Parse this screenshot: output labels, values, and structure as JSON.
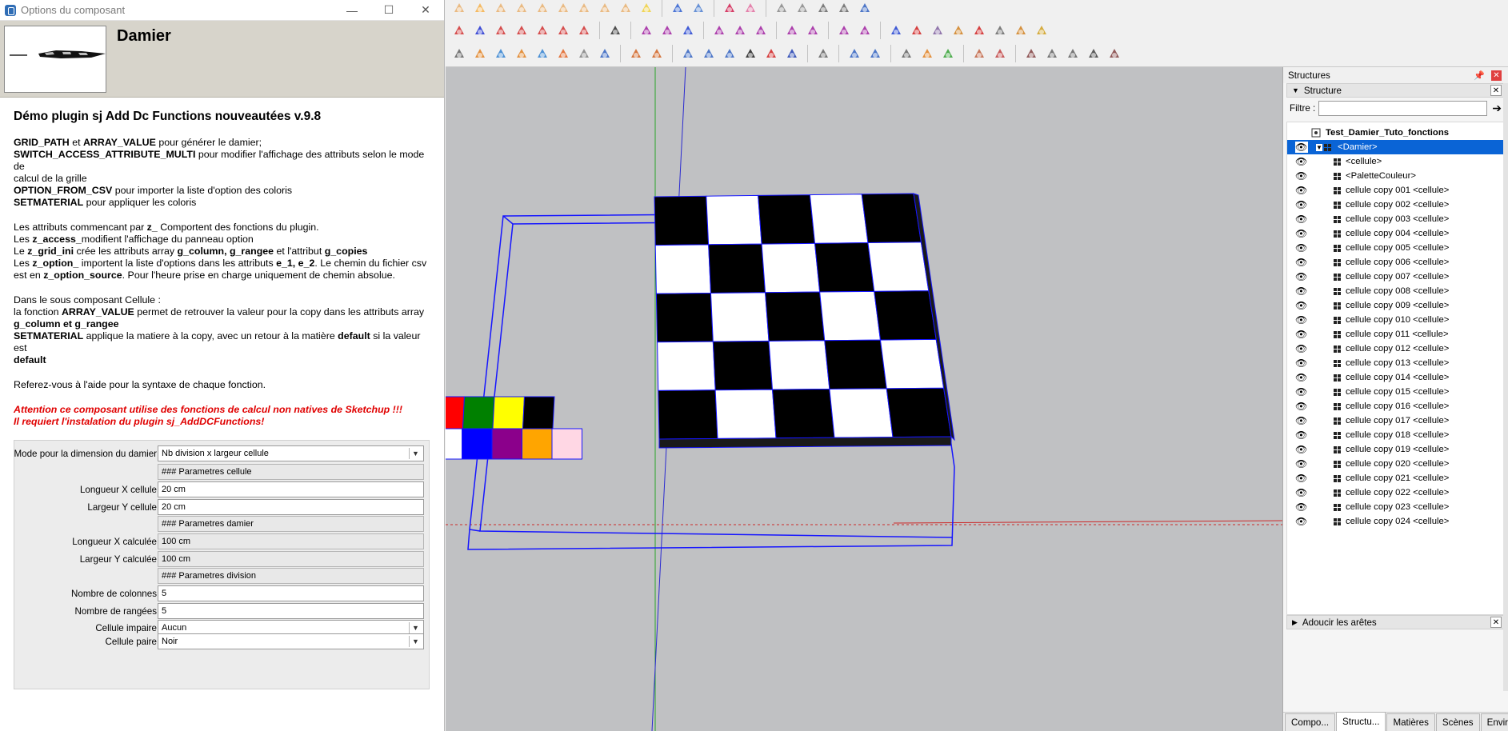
{
  "dialog": {
    "title": "Options du composant",
    "window_buttons": [
      "—",
      "☐",
      "✕"
    ],
    "component_name": "Damier",
    "heading": "Démo plugin sj Add Dc Functions nouveautées v.9.8",
    "paragraphs": [
      {
        "lines": [
          [
            {
              "t": "GRID_PATH",
              "b": true
            },
            {
              "t": " et "
            },
            {
              "t": "ARRAY_VALUE",
              "b": true
            },
            {
              "t": " pour générer le damier;"
            }
          ],
          [
            {
              "t": "SWITCH_ACCESS_ATTRIBUTE_MULTI",
              "b": true
            },
            {
              "t": " pour modifier l'affichage des attributs selon le mode de"
            }
          ],
          [
            {
              "t": "calcul de la grille"
            }
          ],
          [
            {
              "t": "OPTION_FROM_CSV",
              "b": true
            },
            {
              "t": " pour importer la liste d'option des coloris"
            }
          ],
          [
            {
              "t": "SETMATERIAL",
              "b": true
            },
            {
              "t": " pour appliquer les coloris"
            }
          ]
        ]
      },
      {
        "lines": [
          [
            {
              "t": "Les attributs commencant par "
            },
            {
              "t": "z_",
              "b": true
            },
            {
              "t": " Comportent des fonctions du plugin."
            }
          ],
          [
            {
              "t": "Les "
            },
            {
              "t": "z_access_",
              "b": true
            },
            {
              "t": "modifient l'affichage du panneau option"
            }
          ],
          [
            {
              "t": "Le "
            },
            {
              "t": "z_grid_ini",
              "b": true
            },
            {
              "t": " crée les attributs array "
            },
            {
              "t": "g_column, g_rangee",
              "b": true
            },
            {
              "t": " et l'attribut "
            },
            {
              "t": "g_copies",
              "b": true
            }
          ],
          [
            {
              "t": "Les "
            },
            {
              "t": "z_option_",
              "b": true
            },
            {
              "t": " importent la liste d'options dans les attributs "
            },
            {
              "t": "e_1, e_2",
              "b": true
            },
            {
              "t": ". Le chemin du fichier csv"
            }
          ],
          [
            {
              "t": "est en "
            },
            {
              "t": "z_option_source",
              "b": true
            },
            {
              "t": ". Pour l'heure prise en charge uniquement de chemin absolue."
            }
          ]
        ]
      },
      {
        "lines": [
          [
            {
              "t": "Dans le sous composant Cellule :"
            }
          ],
          [
            {
              "t": "la fonction "
            },
            {
              "t": "ARRAY_VALUE",
              "b": true
            },
            {
              "t": " permet de retrouver la valeur pour la copy dans les attributs array"
            }
          ],
          [
            {
              "t": "g_column et g_rangee",
              "b": true
            }
          ],
          [
            {
              "t": "SETMATERIAL",
              "b": true
            },
            {
              "t": " applique la matiere à la copy, avec un retour à la matière "
            },
            {
              "t": "default",
              "b": true
            },
            {
              "t": " si la valeur est"
            }
          ],
          [
            {
              "t": "default",
              "b": true
            }
          ]
        ]
      },
      {
        "lines": [
          [
            {
              "t": "Referez-vous à l'aide pour la syntaxe de chaque fonction."
            }
          ]
        ]
      }
    ],
    "warning": [
      "Attention ce composant utilise des fonctions de calcul non natives de Sketchup !!!",
      "Il requiert l'instalation du plugin sj_AddDCFunctions!"
    ],
    "form": [
      {
        "label": "Mode pour la dimension du damier",
        "value": "Nb division x largeur cellule",
        "kind": "select"
      },
      {
        "label": "",
        "value": "### Parametres cellule",
        "kind": "readonly"
      },
      {
        "label": "Longueur X cellule",
        "value": "20 cm",
        "kind": "input"
      },
      {
        "label": "Largeur Y cellule",
        "value": "20 cm",
        "kind": "input"
      },
      {
        "label": "",
        "value": "### Parametres damier",
        "kind": "readonly"
      },
      {
        "label": "Longueur X calculée",
        "value": "100 cm",
        "kind": "readonly"
      },
      {
        "label": "Largeur Y calculée",
        "value": "100 cm",
        "kind": "readonly"
      },
      {
        "label": "",
        "value": "### Parametres division",
        "kind": "readonly"
      },
      {
        "label": "Nombre de colonnes",
        "value": "5",
        "kind": "input"
      },
      {
        "label": "Nombre de rangées",
        "value": "5",
        "kind": "input"
      },
      {
        "label": "Cellule impaire",
        "value": "Aucun",
        "kind": "select"
      },
      {
        "label": "Cellule paire",
        "value": "Noir",
        "kind": "select"
      }
    ]
  },
  "palette_colors": {
    "top": [
      "#ff0000",
      "#008000",
      "#ffff00",
      "#000000"
    ],
    "bottom": [
      "#ffffff",
      "#0000ff",
      "#8b008b",
      "#ffa500",
      "#ffd7e4"
    ]
  },
  "tray": {
    "title": "Structures",
    "section": "Structure",
    "filter_label": "Filtre :",
    "model_name": "Test_Damier_Tuto_fonctions",
    "items": [
      "<Damier>",
      "<cellule>",
      "<PaletteCouleur>",
      "cellule copy 001 <cellule>",
      "cellule copy 002 <cellule>",
      "cellule copy 003 <cellule>",
      "cellule copy 004 <cellule>",
      "cellule copy 005 <cellule>",
      "cellule copy 006 <cellule>",
      "cellule copy 007 <cellule>",
      "cellule copy 008 <cellule>",
      "cellule copy 009 <cellule>",
      "cellule copy 010 <cellule>",
      "cellule copy 011 <cellule>",
      "cellule copy 012 <cellule>",
      "cellule copy 013 <cellule>",
      "cellule copy 014 <cellule>",
      "cellule copy 015 <cellule>",
      "cellule copy 016 <cellule>",
      "cellule copy 017 <cellule>",
      "cellule copy 018 <cellule>",
      "cellule copy 019 <cellule>",
      "cellule copy 020 <cellule>",
      "cellule copy 021 <cellule>",
      "cellule copy 022 <cellule>",
      "cellule copy 023 <cellule>",
      "cellule copy 024 <cellule>"
    ],
    "soften_section": "Adoucir les arêtes",
    "tabs": [
      "Compo...",
      "Structu...",
      "Matières",
      "Scènes",
      "Enviro..."
    ],
    "active_tab": 1
  }
}
